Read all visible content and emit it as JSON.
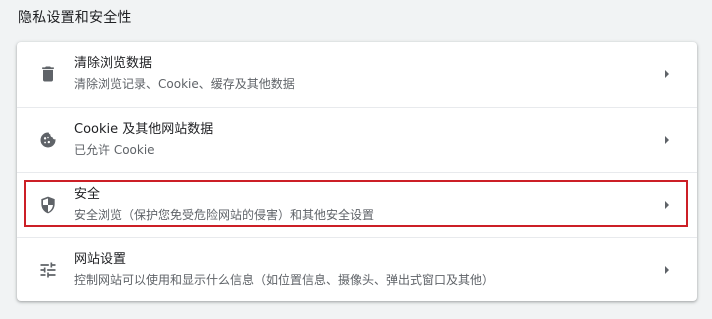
{
  "section": {
    "title": "隐私设置和安全性"
  },
  "items": [
    {
      "title": "清除浏览数据",
      "subtitle": "清除浏览记录、Cookie、缓存及其他数据",
      "icon": "trash-icon"
    },
    {
      "title": "Cookie 及其他网站数据",
      "subtitle": "已允许 Cookie",
      "icon": "cookie-icon"
    },
    {
      "title": "安全",
      "subtitle": "安全浏览（保护您免受危险网站的侵害）和其他安全设置",
      "icon": "shield-icon"
    },
    {
      "title": "网站设置",
      "subtitle": "控制网站可以使用和显示什么信息（如位置信息、摄像头、弹出式窗口及其他）",
      "icon": "tune-icon"
    }
  ],
  "colors": {
    "highlight": "#cc1f26",
    "icon": "#5f6368",
    "background": "#f1f3f4"
  }
}
